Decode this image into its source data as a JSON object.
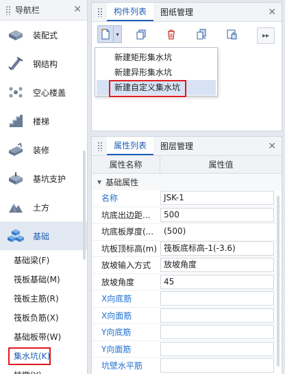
{
  "nav": {
    "title": "导航栏",
    "close": "✕",
    "items": [
      {
        "label": "装配式",
        "icon": "prefab-icon"
      },
      {
        "label": "钢结构",
        "icon": "steel-structure-icon"
      },
      {
        "label": "空心楼盖",
        "icon": "hollow-slab-icon"
      },
      {
        "label": "楼梯",
        "icon": "stairs-icon"
      },
      {
        "label": "装修",
        "icon": "decoration-icon"
      },
      {
        "label": "基坑支护",
        "icon": "pit-support-icon"
      },
      {
        "label": "土方",
        "icon": "earthwork-icon"
      },
      {
        "label": "基础",
        "icon": "foundation-icon"
      }
    ],
    "sub_items": [
      {
        "label": "基础梁(F)"
      },
      {
        "label": "筏板基础(M)"
      },
      {
        "label": "筏板主筋(R)"
      },
      {
        "label": "筏板负筋(X)"
      },
      {
        "label": "基础板带(W)"
      },
      {
        "label": "集水坑(K)"
      },
      {
        "label": "柱墩(Y)"
      }
    ]
  },
  "component_pane": {
    "tabs": [
      "构件列表",
      "图纸管理"
    ],
    "close": "✕",
    "toolbar": {
      "new": "new-component-icon",
      "copy": "copy-icon",
      "delete": "delete-icon",
      "layer_copy": "layer-copy-icon",
      "lock": "lock-icon",
      "more": "▸▸"
    },
    "menu": [
      {
        "label": "新建矩形集水坑"
      },
      {
        "label": "新建异形集水坑"
      },
      {
        "label": "新建自定义集水坑"
      }
    ]
  },
  "props_pane": {
    "tabs": [
      "属性列表",
      "图层管理"
    ],
    "close": "✕",
    "col_name": "属性名称",
    "col_value": "属性值",
    "group": "基础属性",
    "rows": [
      {
        "key": "名称",
        "value": "JSK-1",
        "blue": true
      },
      {
        "key": "坑底出边距...",
        "value": "500",
        "blue": false
      },
      {
        "key": "坑底板厚度(...",
        "value": "(500)",
        "blue": false
      },
      {
        "key": "坑板顶标高(m)",
        "value": "筏板底标高-1(-3.6)",
        "blue": false
      },
      {
        "key": "放坡输入方式",
        "value": "放坡角度",
        "blue": false
      },
      {
        "key": "放坡角度",
        "value": "45",
        "blue": false
      },
      {
        "key": "X向底筋",
        "value": "",
        "blue": true
      },
      {
        "key": "X向面筋",
        "value": "",
        "blue": true
      },
      {
        "key": "Y向底筋",
        "value": "",
        "blue": true
      },
      {
        "key": "Y向面筋",
        "value": "",
        "blue": true
      },
      {
        "key": "坑壁水平筋",
        "value": "",
        "blue": true
      }
    ]
  },
  "colors": {
    "accent": "#1f5fb5",
    "highlight_box": "#e0181e"
  }
}
